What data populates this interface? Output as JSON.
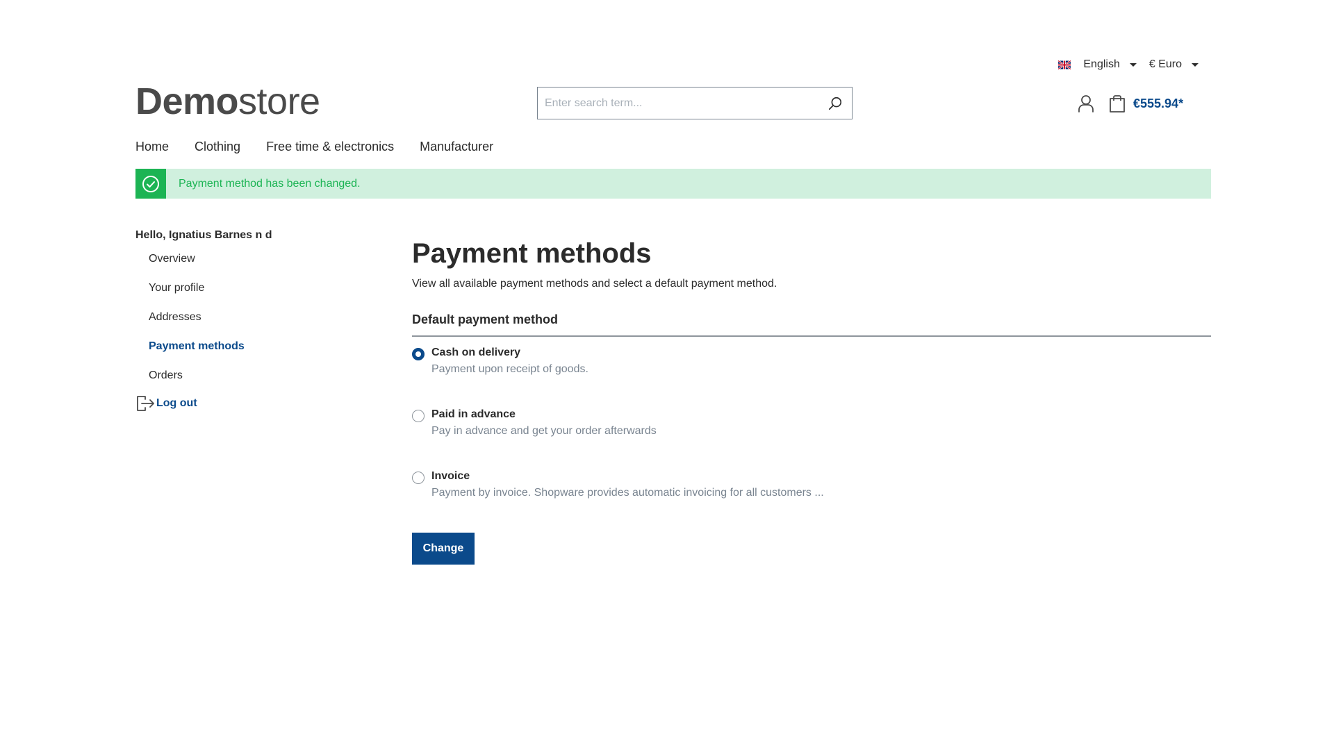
{
  "topbar": {
    "language": {
      "icon": "uk-flag-icon",
      "label": "English"
    },
    "currency": {
      "label": "€ Euro"
    }
  },
  "header": {
    "logo": {
      "bold": "Demo",
      "light": "store"
    },
    "search": {
      "placeholder": "Enter search term...",
      "value": "",
      "icon": "search-icon"
    },
    "account_icon": "user-icon",
    "cart": {
      "icon": "shopping-bag-icon",
      "total": "€555.94*"
    }
  },
  "nav": {
    "items": [
      {
        "label": "Home"
      },
      {
        "label": "Clothing"
      },
      {
        "label": "Free time & electronics"
      },
      {
        "label": "Manufacturer"
      }
    ]
  },
  "alert": {
    "icon": "check-circle-icon",
    "message": "Payment method has been changed.",
    "colors": {
      "icon_bg": "#1cb454",
      "bg": "#d0f0de",
      "text": "#1cb454"
    }
  },
  "sidebar": {
    "greeting": "Hello, Ignatius Barnes n d",
    "items": [
      {
        "label": "Overview",
        "active": false
      },
      {
        "label": "Your profile",
        "active": false
      },
      {
        "label": "Addresses",
        "active": false
      },
      {
        "label": "Payment methods",
        "active": true
      },
      {
        "label": "Orders",
        "active": false
      }
    ],
    "logout": {
      "icon": "logout-icon",
      "label": "Log out"
    }
  },
  "main": {
    "title": "Payment methods",
    "description": "View all available payment methods and select a default payment method.",
    "section_title": "Default payment method",
    "methods": [
      {
        "label": "Cash on delivery",
        "description": "Payment upon receipt of goods.",
        "selected": true
      },
      {
        "label": "Paid in advance",
        "description": "Pay in advance and get your order afterwards",
        "selected": false
      },
      {
        "label": "Invoice",
        "description": "Payment by invoice. Shopware provides automatic invoicing for all customers ...",
        "selected": false
      }
    ],
    "submit_label": "Change"
  },
  "colors": {
    "primary": "#0b4a8b",
    "text": "#2b2b2b",
    "muted": "#798490"
  }
}
